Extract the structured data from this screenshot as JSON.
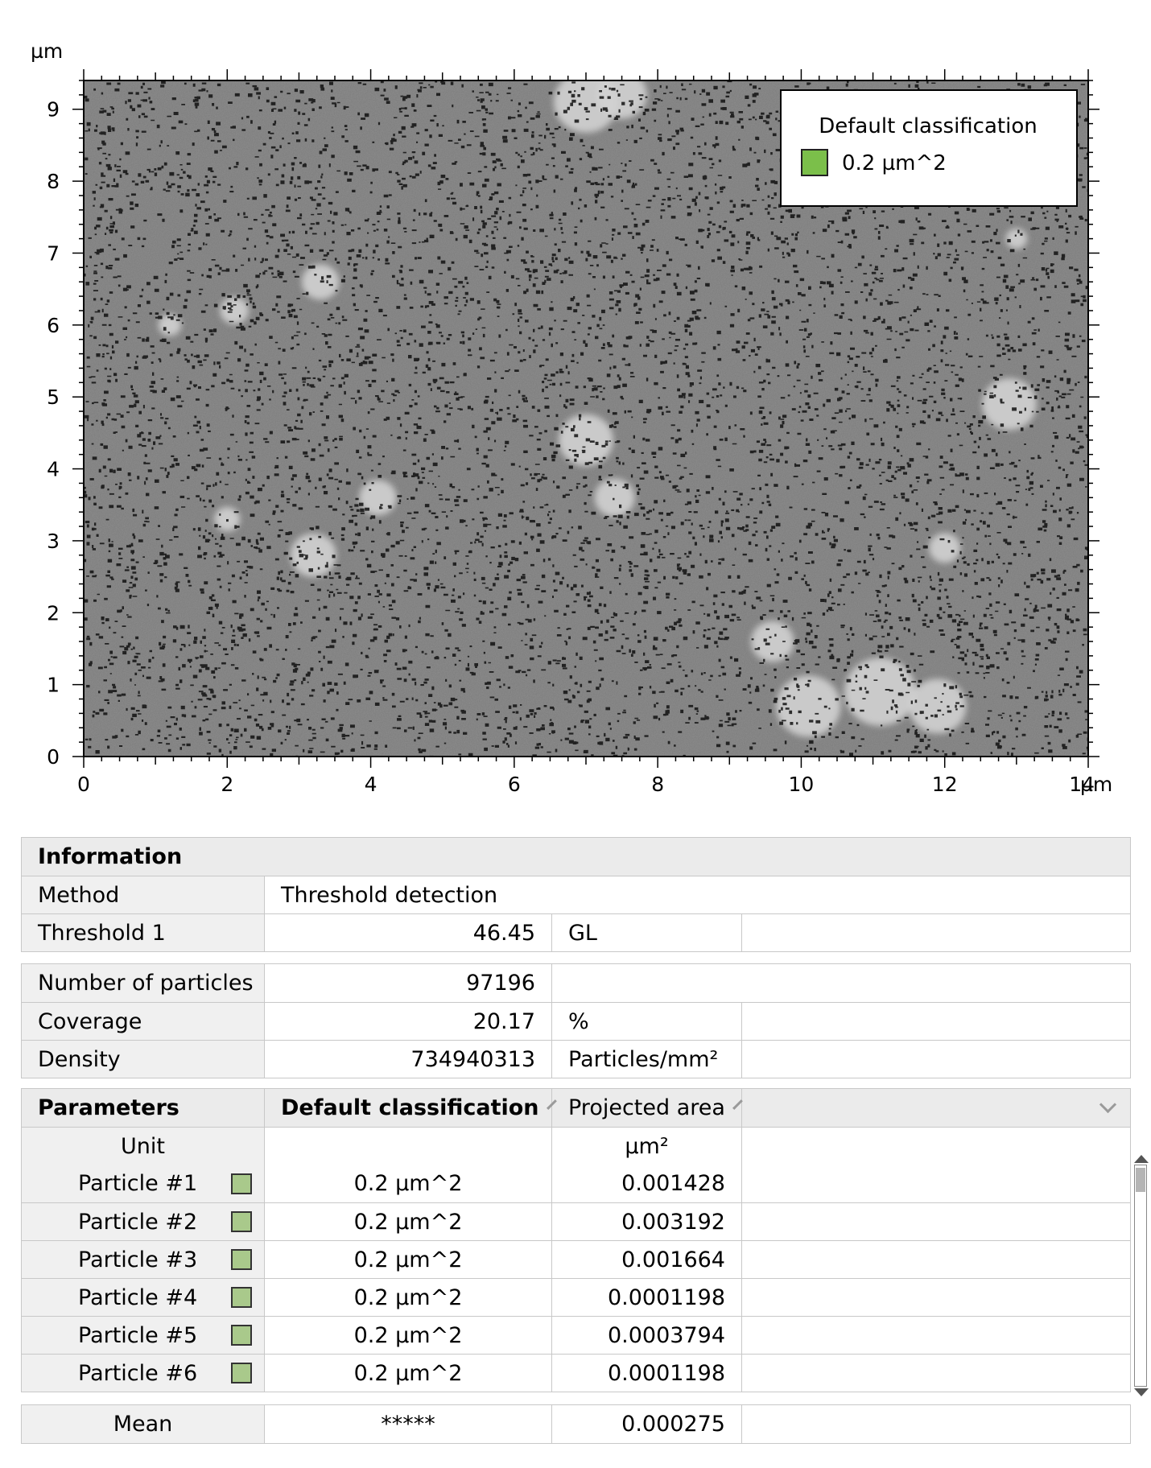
{
  "plot": {
    "y_unit": "µm",
    "x_unit": "µm",
    "x_ticks": [
      "0",
      "2",
      "4",
      "6",
      "8",
      "10",
      "12",
      "14"
    ],
    "y_ticks": [
      "0",
      "1",
      "2",
      "3",
      "4",
      "5",
      "6",
      "7",
      "8",
      "9"
    ],
    "x_range": [
      0,
      14
    ],
    "y_range": [
      0,
      9.4
    ],
    "legend": {
      "title": "Default classification",
      "entry": "0.2 µm^2",
      "swatch_color": "#7bbf4a"
    },
    "image_colors": {
      "background": "#7a7a7a",
      "particles": "#111111",
      "grains": "#d2d2d2"
    }
  },
  "information": {
    "header": "Information",
    "method_label": "Method",
    "method_value": "Threshold detection",
    "threshold_label": "Threshold 1",
    "threshold_value": "46.45",
    "threshold_unit": "GL"
  },
  "stats": {
    "count_label": "Number of particles",
    "count_value": "97196",
    "coverage_label": "Coverage",
    "coverage_value": "20.17",
    "coverage_unit": "%",
    "density_label": "Density",
    "density_value": "734940313",
    "density_unit": "Particles/mm²"
  },
  "parameters": {
    "header": "Parameters",
    "col_class": "Default classification",
    "col_area": "Projected area",
    "unit_label": "Unit",
    "area_unit": "µm²",
    "swatch_color": "#a9c98b",
    "particles": [
      {
        "name": "Particle #1",
        "class": "0.2 µm^2",
        "area": "0.001428"
      },
      {
        "name": "Particle #2",
        "class": "0.2 µm^2",
        "area": "0.003192"
      },
      {
        "name": "Particle #3",
        "class": "0.2 µm^2",
        "area": "0.001664"
      },
      {
        "name": "Particle #4",
        "class": "0.2 µm^2",
        "area": "0.0001198"
      },
      {
        "name": "Particle #5",
        "class": "0.2 µm^2",
        "area": "0.0003794"
      },
      {
        "name": "Particle #6",
        "class": "0.2 µm^2",
        "area": "0.0001198"
      }
    ]
  },
  "mean": {
    "label": "Mean",
    "class": "*****",
    "area": "0.000275"
  }
}
